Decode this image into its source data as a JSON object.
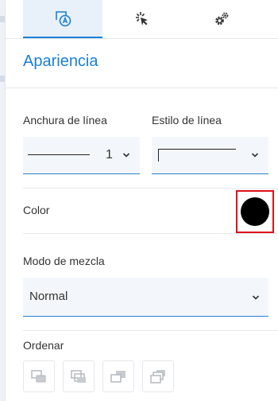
{
  "tabs": [
    {
      "name": "appearance",
      "icon": "shape-style-icon",
      "active": true
    },
    {
      "name": "interaction",
      "icon": "cursor-click-icon",
      "active": false
    },
    {
      "name": "settings",
      "icon": "gears-icon",
      "active": false
    }
  ],
  "section_title": "Apariencia",
  "line_width": {
    "label": "Anchura de línea",
    "value": "1"
  },
  "line_style": {
    "label": "Estilo de línea"
  },
  "color": {
    "label": "Color",
    "value": "#000000"
  },
  "blend_mode": {
    "label": "Modo de mezcla",
    "value": "Normal"
  },
  "order": {
    "label": "Ordenar",
    "buttons": [
      "bring-to-front-icon",
      "bring-forward-icon",
      "send-backward-icon",
      "send-to-back-icon"
    ]
  },
  "colors": {
    "accent": "#1a7fd6",
    "highlight": "#e0101a"
  }
}
